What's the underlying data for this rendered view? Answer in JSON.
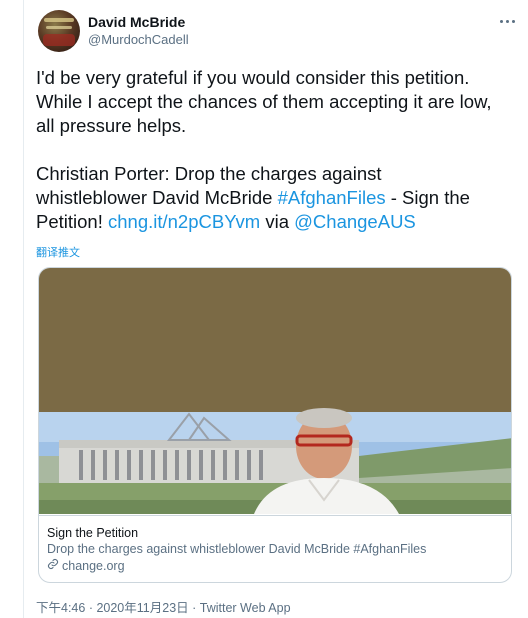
{
  "author": {
    "name": "David McBride",
    "handle": "@MurdochCadell"
  },
  "tweet": {
    "line1": "I'd be very grateful if you would consider this petition.",
    "line2": "While I accept the chances of them accepting it are low,",
    "line3": "all pressure helps.",
    "line4": "Christian Porter: Drop the charges against",
    "line5_text": "whistleblower David McBride ",
    "line5_hashtag": "#AfghanFiles",
    "line5_rest": " - Sign the",
    "line6_text": "Petition! ",
    "line6_link": "chng.it/n2pCBYvm",
    "line6_via": " via ",
    "line6_mention": "@ChangeAUS"
  },
  "translate_label": "翻译推文",
  "card": {
    "title": "Sign the Petition",
    "description": "Drop the charges against whistleblower David McBride #AfghanFiles",
    "domain": "change.org"
  },
  "meta": {
    "time": "下午4:46",
    "separator1": " · ",
    "date": "2020年11月23日",
    "separator2": " · ",
    "source": "Twitter Web App"
  },
  "icons": {
    "more": "more-dots-icon",
    "link": "link-icon"
  },
  "colors": {
    "link": "#1b95e0",
    "secondary_text": "#5b7083",
    "card_image_bg": "#7b6a45",
    "border": "#ccd6dd"
  }
}
